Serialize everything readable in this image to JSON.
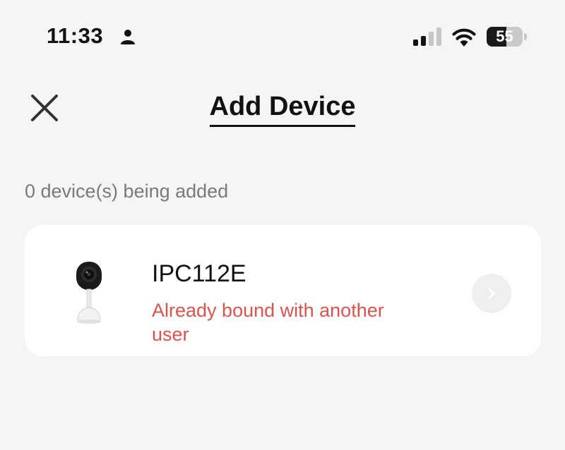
{
  "status_bar": {
    "time": "11:33",
    "battery_level": "55",
    "battery_fraction": 0.55
  },
  "header": {
    "title": "Add Device",
    "close_icon": "close-icon"
  },
  "summary": {
    "count_text": "0 device(s) being added"
  },
  "device": {
    "name": "IPC112E",
    "status": "Already bound with another user",
    "status_color": "#d9534f",
    "icon": "camera-icon",
    "action_icon": "chevron-right-icon"
  }
}
